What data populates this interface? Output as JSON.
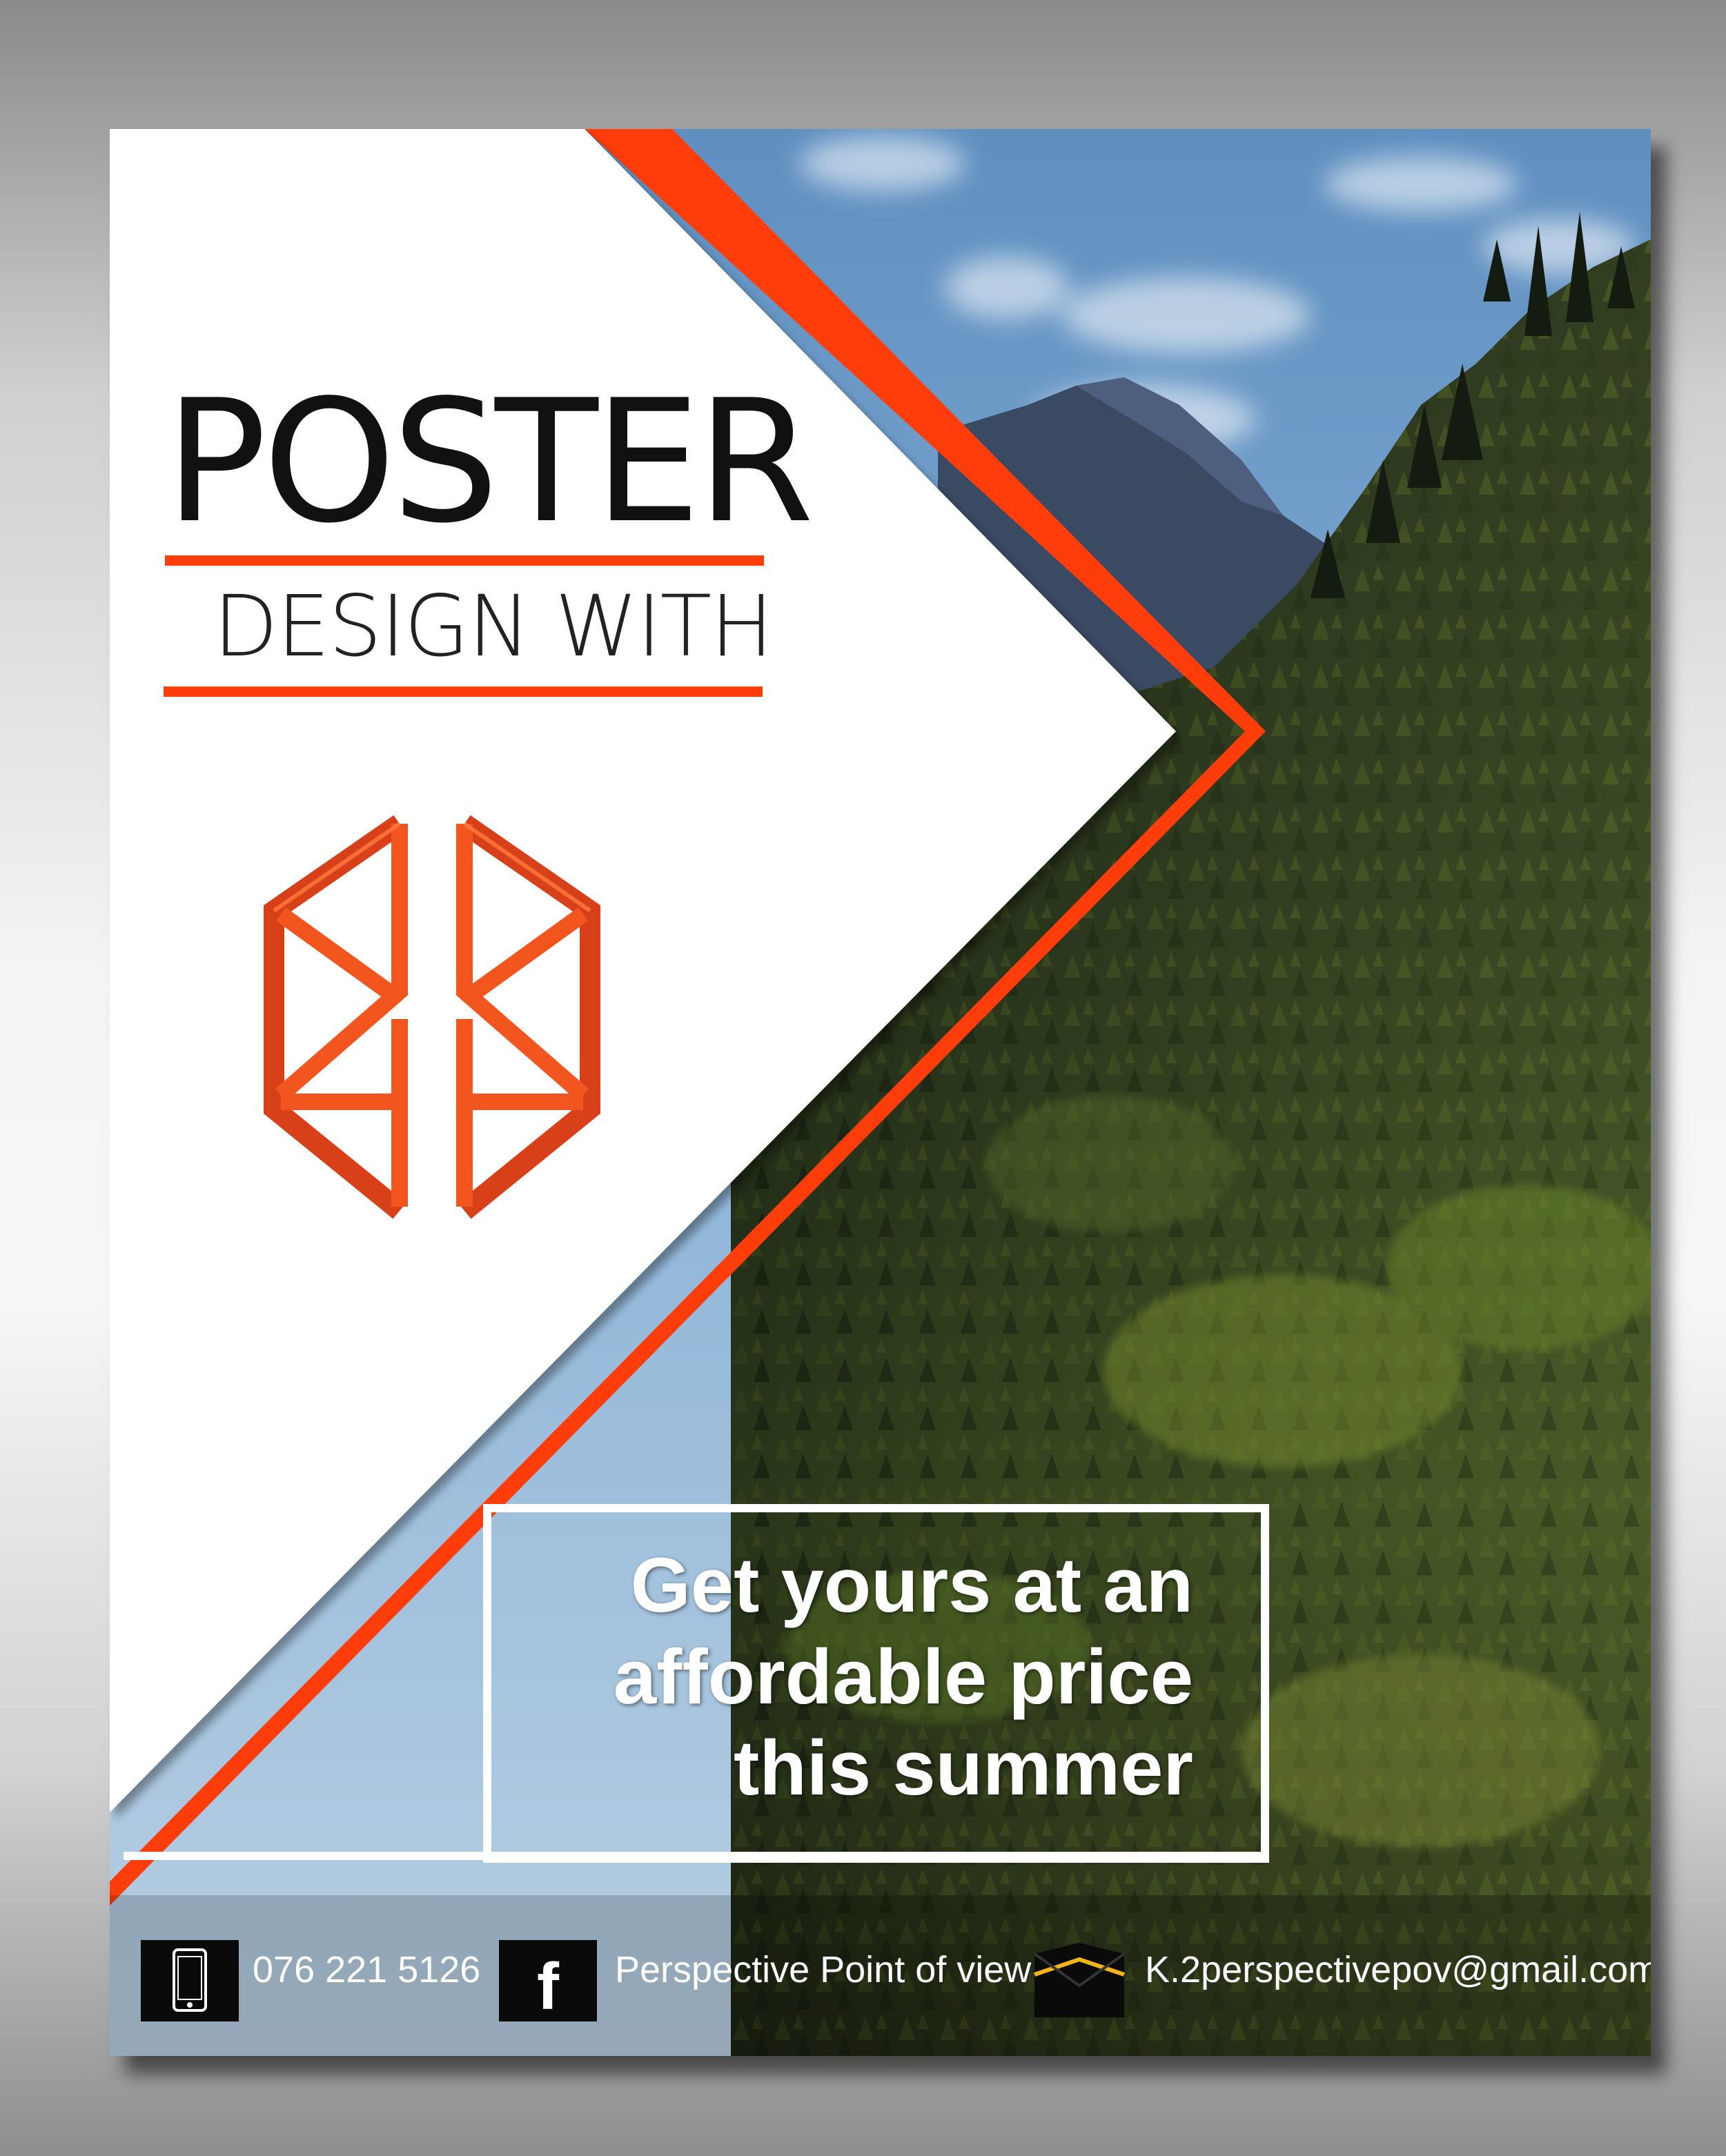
{
  "poster": {
    "title": "POSTER",
    "subtitle": "DESIGN WITH",
    "tagline": [
      "Get yours at an",
      "affordable price",
      "this summer"
    ],
    "contact": {
      "phone": "076 221 5126",
      "facebook": "Perspective Point of view",
      "email": "K.2perspectivepov@gmail.com"
    },
    "logo_icon": "impossible-cube-logo",
    "colors": {
      "accent": "#ff3d0a",
      "logo_orange": "#f2551e",
      "panel": "#ffffff",
      "text_dark": "#111111"
    }
  }
}
